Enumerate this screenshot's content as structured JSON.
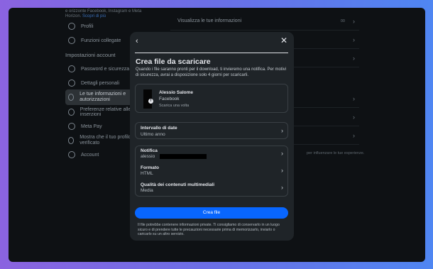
{
  "background": {
    "top_note": "e orizzonte Facebook, Instagram e Meta Horizon.",
    "top_link": "Scopri di più",
    "sidebar_items_top": [
      "Profili",
      "Funzioni collegate"
    ],
    "section_title": "Impostazioni account",
    "sidebar_items": [
      "Password e sicurezza",
      "Dettagli personali",
      "Le tue informazioni e autorizzazioni",
      "Preferenze relative alle inserzioni",
      "Meta Pay",
      "Mostra che il tuo profilo è verificato",
      "Account"
    ],
    "main_rows": [
      "Visualizza le tue informazioni"
    ],
    "main_row_badge": "00",
    "main_note": "per influenzare le tue esperienze."
  },
  "modal": {
    "title": "Crea file da scaricare",
    "description": "Quando i file saranno pronti per il download, ti invieremo una notifica. Per motivi di sicurezza, avrai a disposizione solo 4 giorni per scaricarli.",
    "profile": {
      "name": "Alessio Salome",
      "app": "Facebook",
      "subtitle": "Scarica una volta"
    },
    "date_range": {
      "label": "Intervallo di date",
      "value": "Ultimo anno"
    },
    "options": [
      {
        "label": "Notifica",
        "value": "alessio"
      },
      {
        "label": "Formato",
        "value": "HTML"
      },
      {
        "label": "Qualità dei contenuti multimediali",
        "value": "Media"
      }
    ],
    "cta_label": "Crea file",
    "footer": "Il file potrebbe contenere informazioni private. Ti consigliamo di conservarlo in un luogo sicuro e di prendere tutte le precauzioni necessarie prima di memorizzarlo, inviarlo o caricarlo su un altro servizio."
  },
  "colors": {
    "accent": "#0866ff",
    "modal_bg": "#1f2428",
    "page_bg": "#0e1114"
  },
  "icons": [
    "back-arrow-icon",
    "close-icon",
    "chevron-right-icon",
    "facebook-badge-icon"
  ]
}
